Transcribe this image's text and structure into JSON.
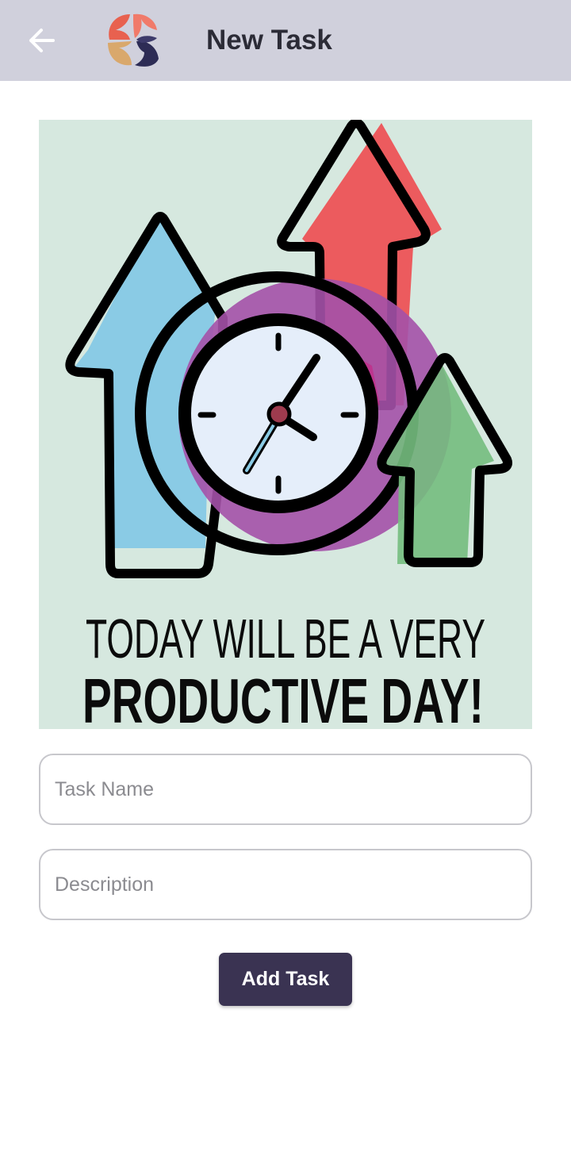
{
  "header": {
    "title": "New Task",
    "back_icon": "arrow-left-icon",
    "logo_icon": "app-logo-icon"
  },
  "banner": {
    "line1": "TODAY WILL BE A VERY",
    "line2": "PRODUCTIVE DAY!",
    "illustration": "clock-with-arrows-icon"
  },
  "form": {
    "task_name_placeholder": "Task Name",
    "task_name_value": "",
    "description_placeholder": "Description",
    "description_value": "",
    "submit_label": "Add Task"
  },
  "colors": {
    "appbar": "#d0d0dc",
    "button": "#3a3352",
    "banner_bg": "#d6e8df"
  }
}
